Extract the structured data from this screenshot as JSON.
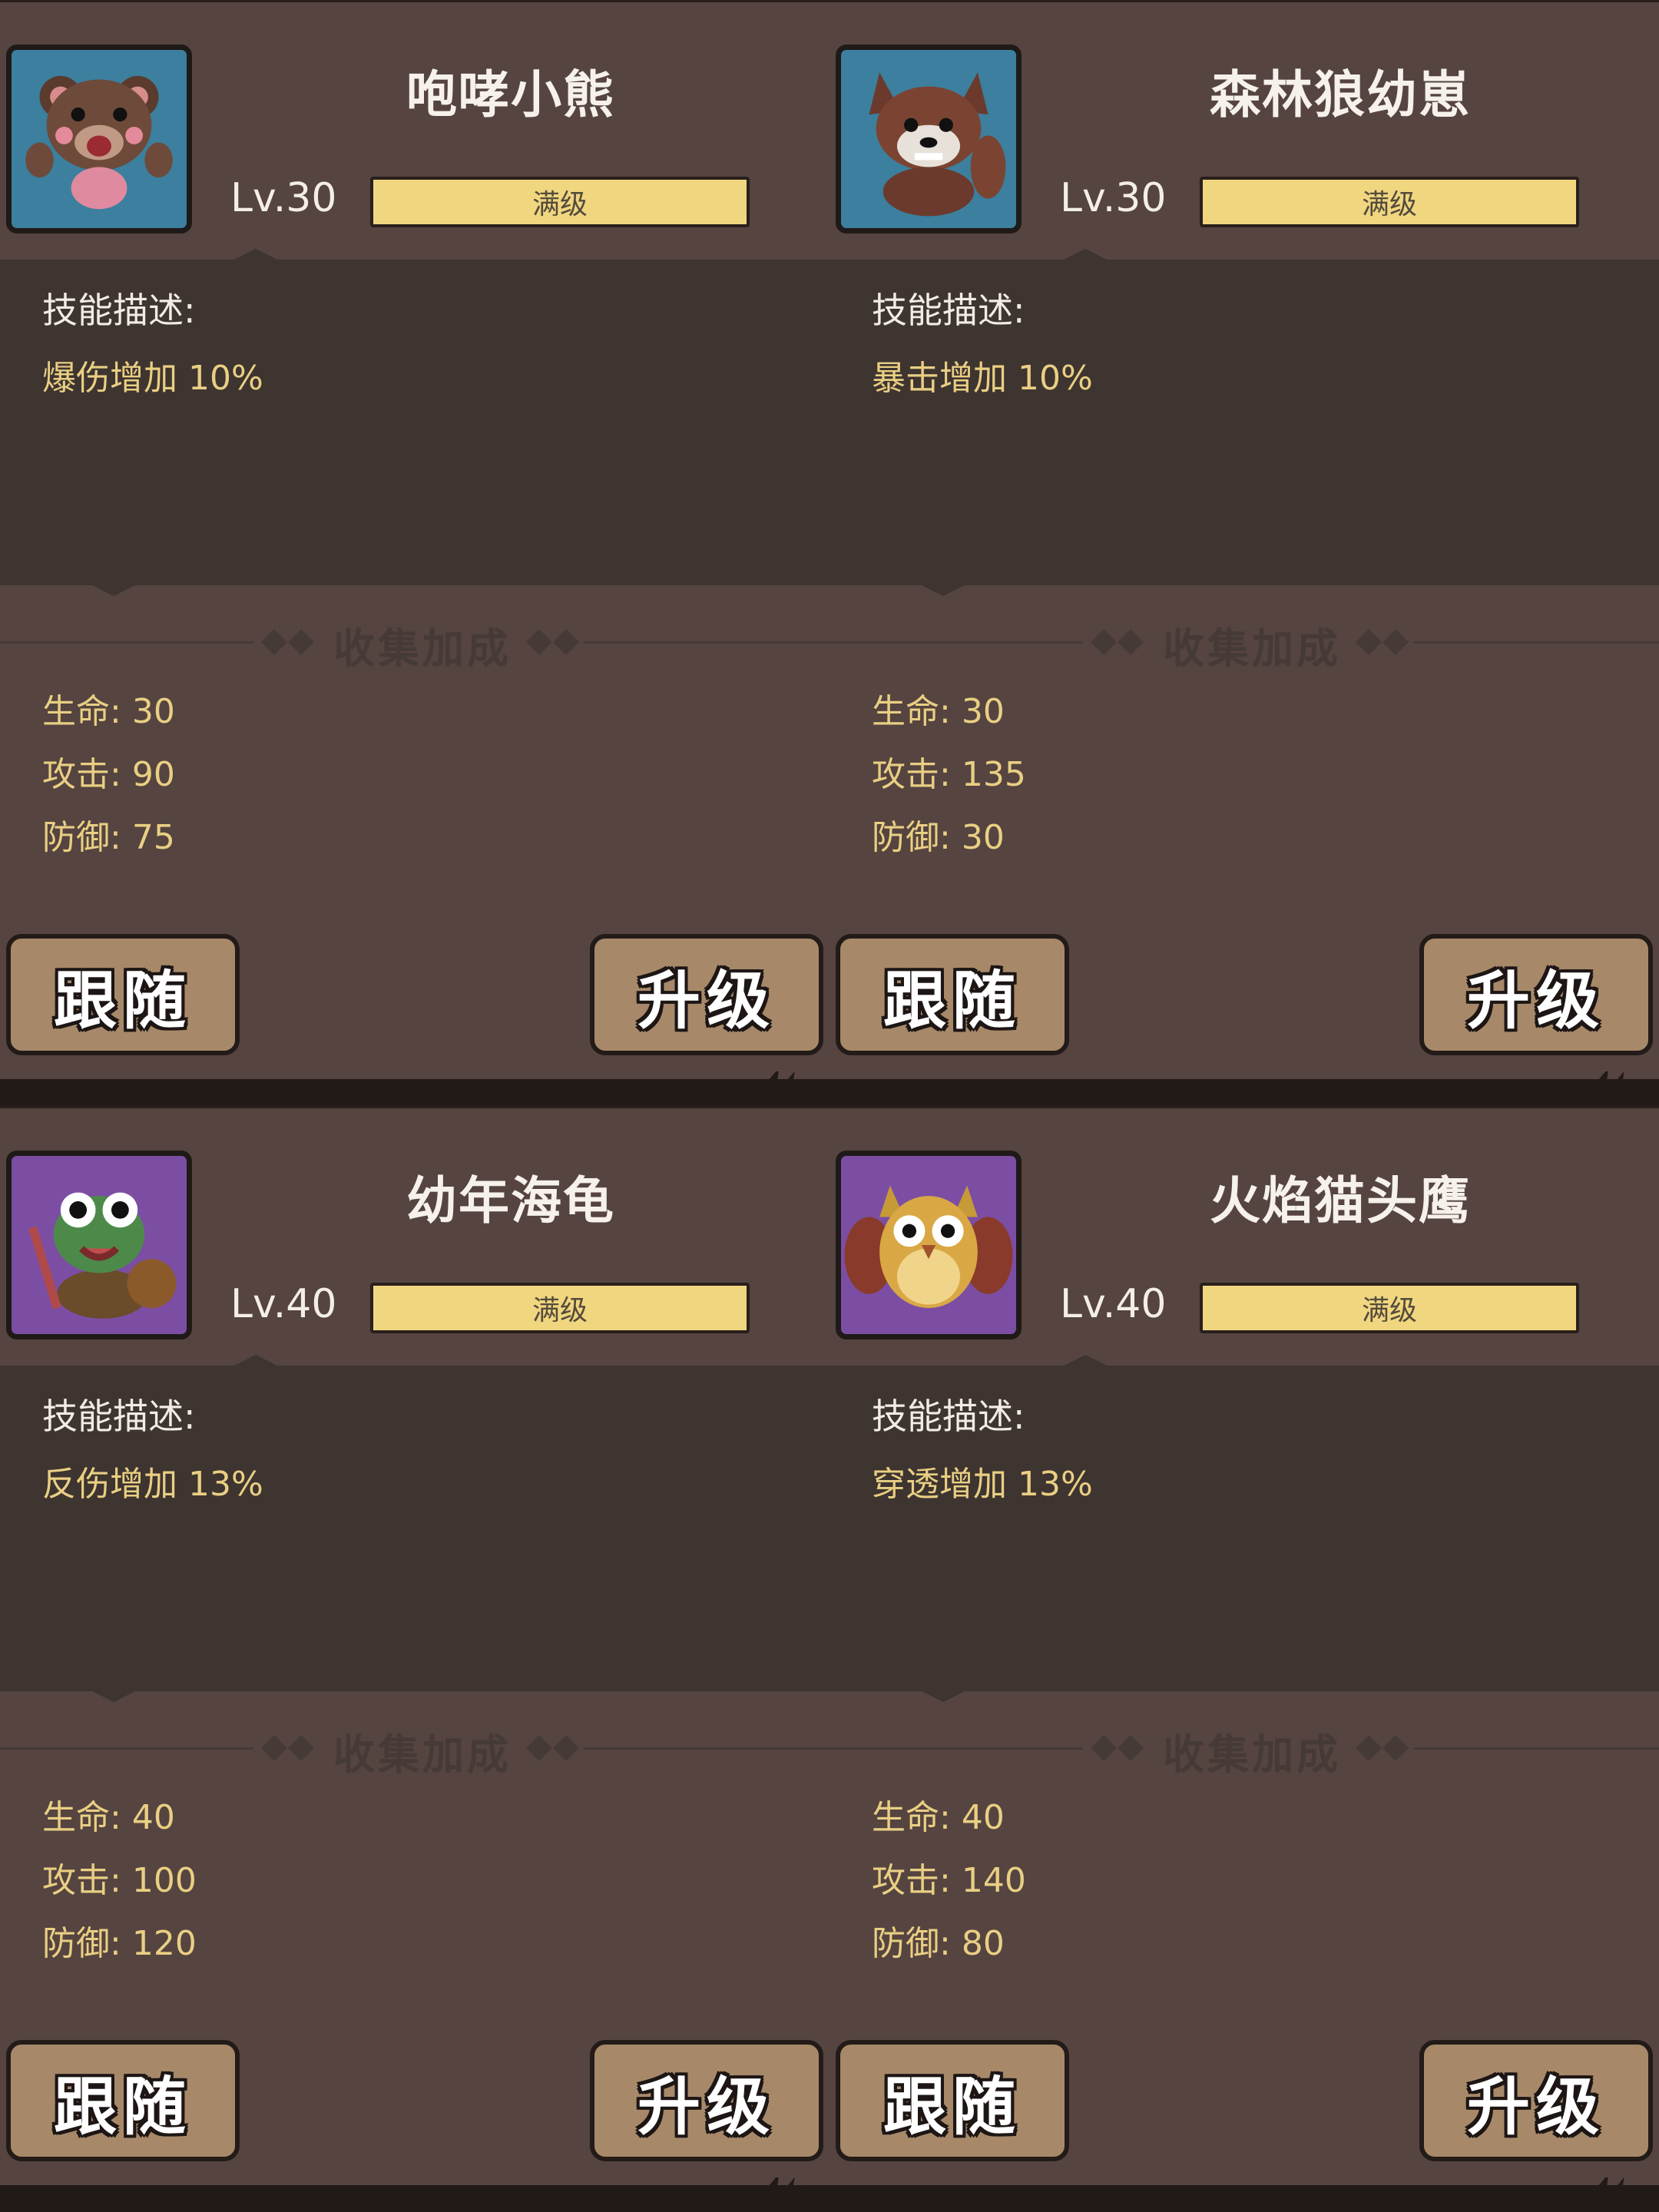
{
  "labels": {
    "skill_title": "技能描述:",
    "bonus_title": "收集加成",
    "follow": "跟随",
    "upgrade": "升级",
    "max_level": "满级",
    "stat_hp": "生命:",
    "stat_atk": "攻击:",
    "stat_def": "防御:"
  },
  "colors": {
    "panel": "#554440",
    "skill_panel": "#3e3430",
    "accent_gold": "#e9cf83",
    "bar_fill": "#f0d67f",
    "button": "#a7896a",
    "avatar_blue": "#3c7f9e",
    "avatar_purple": "#7b4ea3"
  },
  "pets": [
    {
      "name": "咆哮小熊",
      "icon": "bear-icon",
      "level": "Lv.30",
      "progress": 1,
      "skill": "爆伤增加 10%",
      "hp": "30",
      "atk": "90",
      "def": "75"
    },
    {
      "name": "森林狼幼崽",
      "icon": "wolf-icon",
      "level": "Lv.30",
      "progress": 1,
      "skill": "暴击增加 10%",
      "hp": "30",
      "atk": "135",
      "def": "30"
    },
    {
      "name": "幼年海龟",
      "icon": "turtle-icon",
      "level": "Lv.40",
      "progress": 1,
      "skill": "反伤增加 13%",
      "hp": "40",
      "atk": "100",
      "def": "120"
    },
    {
      "name": "火焰猫头鹰",
      "icon": "owl-icon",
      "level": "Lv.40",
      "progress": 1,
      "skill": "穿透增加 13%",
      "hp": "40",
      "atk": "140",
      "def": "80"
    }
  ]
}
